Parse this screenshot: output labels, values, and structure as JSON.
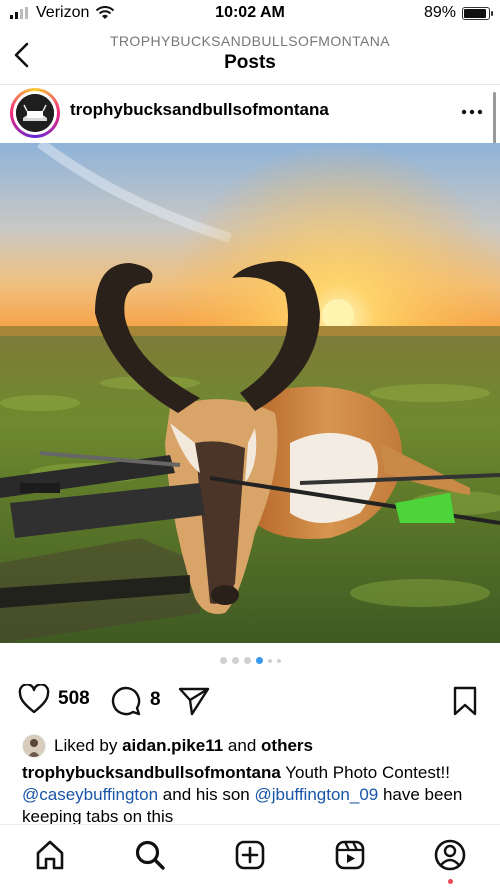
{
  "status_bar": {
    "carrier": "Verizon",
    "time": "10:02 AM",
    "battery": "89%",
    "battery_level": 0.89
  },
  "nav": {
    "account": "TROPHYBUCKSANDBULLSOFMONTANA",
    "title": "Posts"
  },
  "post": {
    "username": "trophybucksandbullsofmontana",
    "carousel": {
      "count": 6,
      "active_index": 3
    },
    "likes_count": "508",
    "comments_count": "8",
    "liked_by_prefix": "Liked by",
    "liked_by_user": "aidan.pike11",
    "liked_by_and": "and",
    "liked_by_others": "others",
    "caption": {
      "author": "trophybucksandbullsofmontana",
      "text1": "Youth Photo Contest!!",
      "mention1": "@caseybuffington",
      "text2": "and his son",
      "mention2": "@jbuffington_09",
      "text3": "have been keeping tabs on this"
    }
  },
  "tabs": [
    {
      "icon": "home-icon"
    },
    {
      "icon": "search-icon"
    },
    {
      "icon": "new-post-icon"
    },
    {
      "icon": "reels-icon"
    },
    {
      "icon": "profile-icon"
    }
  ],
  "colors": {
    "link": "#1a55a8",
    "active_dot": "#3897f0",
    "notification": "#ed4956"
  }
}
